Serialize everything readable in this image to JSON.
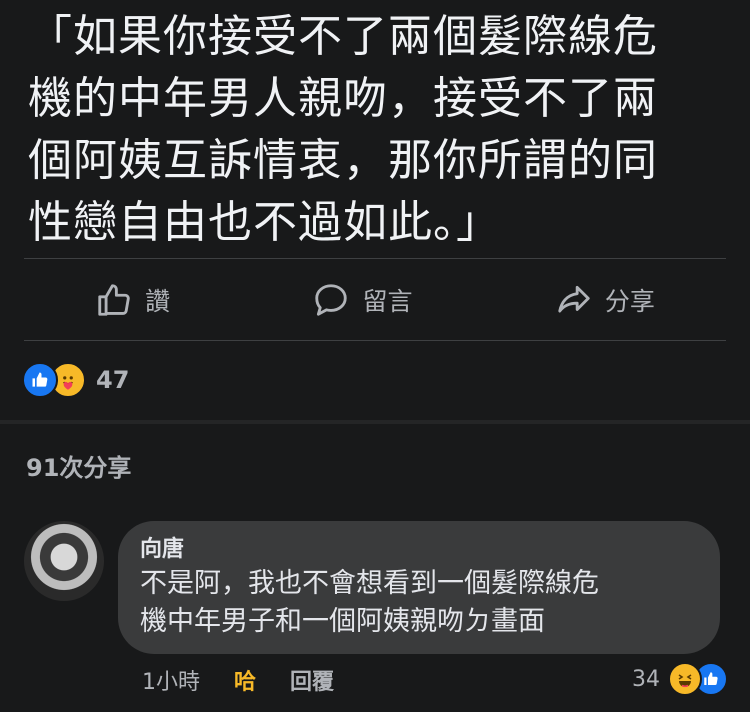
{
  "post": {
    "text": "「如果你接受不了兩個髮際線危\n機的中年男人親吻，接受不了兩\n個阿姨互訴情衷，那你所謂的同\n性戀自由也不過如此。」"
  },
  "actions": {
    "like_label": "讚",
    "comment_label": "留言",
    "share_label": "分享"
  },
  "reactions": {
    "count": "47",
    "icons": [
      "like-icon",
      "care-icon"
    ]
  },
  "shares": {
    "label": "91次分享"
  },
  "comment": {
    "author": "向唐",
    "text": "不是阿，我也不會想看到一個髮際線危\n機中年男子和一個阿姨親吻ㄉ畫面",
    "time": "1小時",
    "reaction_link": "哈",
    "reply_label": "回覆",
    "reaction_count": "34",
    "reaction_icons": [
      "haha-icon",
      "like-icon"
    ]
  },
  "colors": {
    "background": "#18191a",
    "bubble": "#3a3b3c",
    "like_blue": "#1877f2",
    "haha_yellow": "#f7b928",
    "muted_text": "#b0b3b8"
  }
}
